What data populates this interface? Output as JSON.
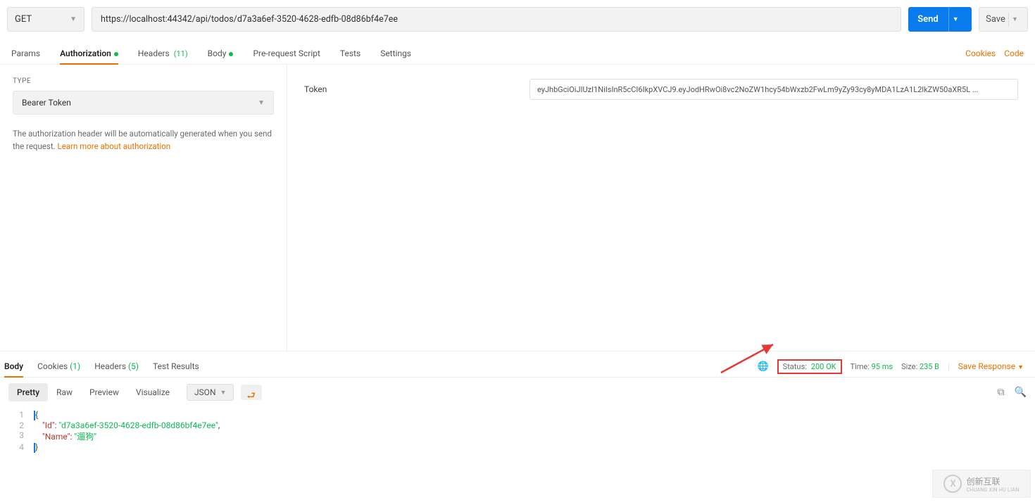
{
  "request": {
    "method": "GET",
    "url": "https://localhost:44342/api/todos/d7a3a6ef-3520-4628-edfb-08d86bf4e7ee",
    "send_label": "Send",
    "save_label": "Save"
  },
  "req_tabs": {
    "params": "Params",
    "auth": "Authorization",
    "headers": "Headers",
    "headers_count": "(11)",
    "body": "Body",
    "prerequest": "Pre-request Script",
    "tests": "Tests",
    "settings": "Settings",
    "cookies_link": "Cookies",
    "code_link": "Code"
  },
  "auth": {
    "type_label": "TYPE",
    "type_value": "Bearer Token",
    "help_1": "The authorization header will be automatically generated when you send the request. ",
    "help_link": "Learn more about authorization",
    "token_label": "Token",
    "token_value": "eyJhbGciOiJIUzI1NiIsInR5cCI6IkpXVCJ9.eyJodHRwOi8vc2NoZW1hcy54bWxzb2FwLm9yZy93cy8yMDA1LzA1L2lkZW50aXR5L ..."
  },
  "res_tabs": {
    "body": "Body",
    "cookies": "Cookies",
    "cookies_count": "(1)",
    "headers": "Headers",
    "headers_count": "(5)",
    "test_results": "Test Results"
  },
  "res_meta": {
    "status_label": "Status:",
    "status_value": "200 OK",
    "time_label": "Time:",
    "time_value": "95 ms",
    "size_label": "Size:",
    "size_value": "235 B",
    "save_response": "Save Response"
  },
  "res_toolbar": {
    "pretty": "Pretty",
    "raw": "Raw",
    "preview": "Preview",
    "visualize": "Visualize",
    "format": "JSON"
  },
  "response_json": {
    "lines": [
      "1",
      "2",
      "3",
      "4"
    ],
    "id_key": "\"Id\"",
    "id_val": "\"d7a3a6ef-3520-4628-edfb-08d86bf4e7ee\"",
    "name_key": "\"Name\"",
    "name_val": "\"遛狗\""
  },
  "watermark": {
    "brand": "创新互联",
    "sub": "CHUANG XIN HU LIAN"
  }
}
